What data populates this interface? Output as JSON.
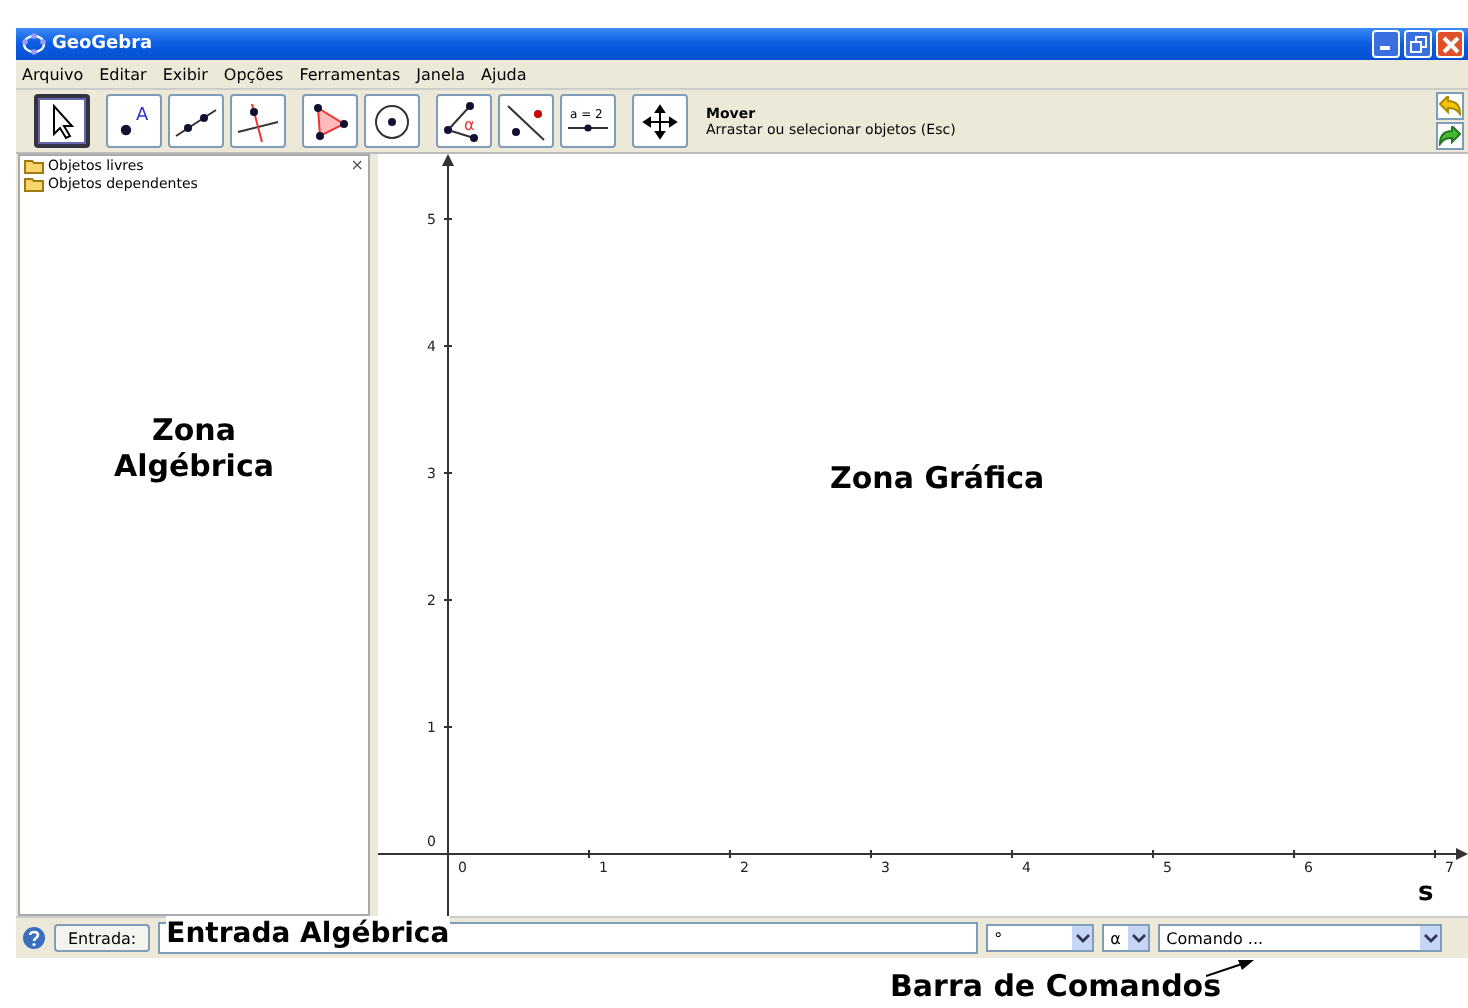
{
  "window": {
    "title": "GeoGebra"
  },
  "menu": [
    "Arquivo",
    "Editar",
    "Exibir",
    "Opções",
    "Ferramentas",
    "Janela",
    "Ajuda"
  ],
  "tool_groups": [
    {
      "tools": [
        {
          "kind": "move",
          "selected": true
        }
      ]
    },
    {
      "tools": [
        {
          "kind": "point",
          "label": "A",
          "selected": false
        },
        {
          "kind": "line",
          "selected": false
        },
        {
          "kind": "perpendicular",
          "selected": false
        }
      ]
    },
    {
      "tools": [
        {
          "kind": "polygon",
          "selected": false
        },
        {
          "kind": "circle",
          "selected": false
        }
      ]
    },
    {
      "tools": [
        {
          "kind": "angle",
          "label": "α",
          "selected": false
        },
        {
          "kind": "reflect",
          "selected": false
        },
        {
          "kind": "slider",
          "label": "a = 2",
          "selected": false
        }
      ]
    },
    {
      "tools": [
        {
          "kind": "move_view",
          "selected": false
        }
      ]
    }
  ],
  "tool_info": {
    "name": "Mover",
    "description": "Arrastar ou selecionar objetos (Esc)"
  },
  "algebra_view": {
    "items": [
      {
        "label": "Objetos livres"
      },
      {
        "label": "Objetos dependentes"
      }
    ],
    "close": "×",
    "annotation": "Zona Algébrica"
  },
  "graphics_view": {
    "annotation": "Zona Gráfica",
    "x_ticks": [
      "0",
      "1",
      "2",
      "3",
      "4",
      "5",
      "6",
      "7"
    ],
    "y_ticks": [
      "5",
      "4",
      "3",
      "2",
      "1",
      "0"
    ],
    "corner_label": "s"
  },
  "input_bar": {
    "button": "Entrada:",
    "annotation": "Entrada Algébrica",
    "symbol_dropdown": "°",
    "greek_dropdown": "α",
    "command_dropdown": "Comando ..."
  },
  "command_bar_annotation": "Barra de Comandos"
}
